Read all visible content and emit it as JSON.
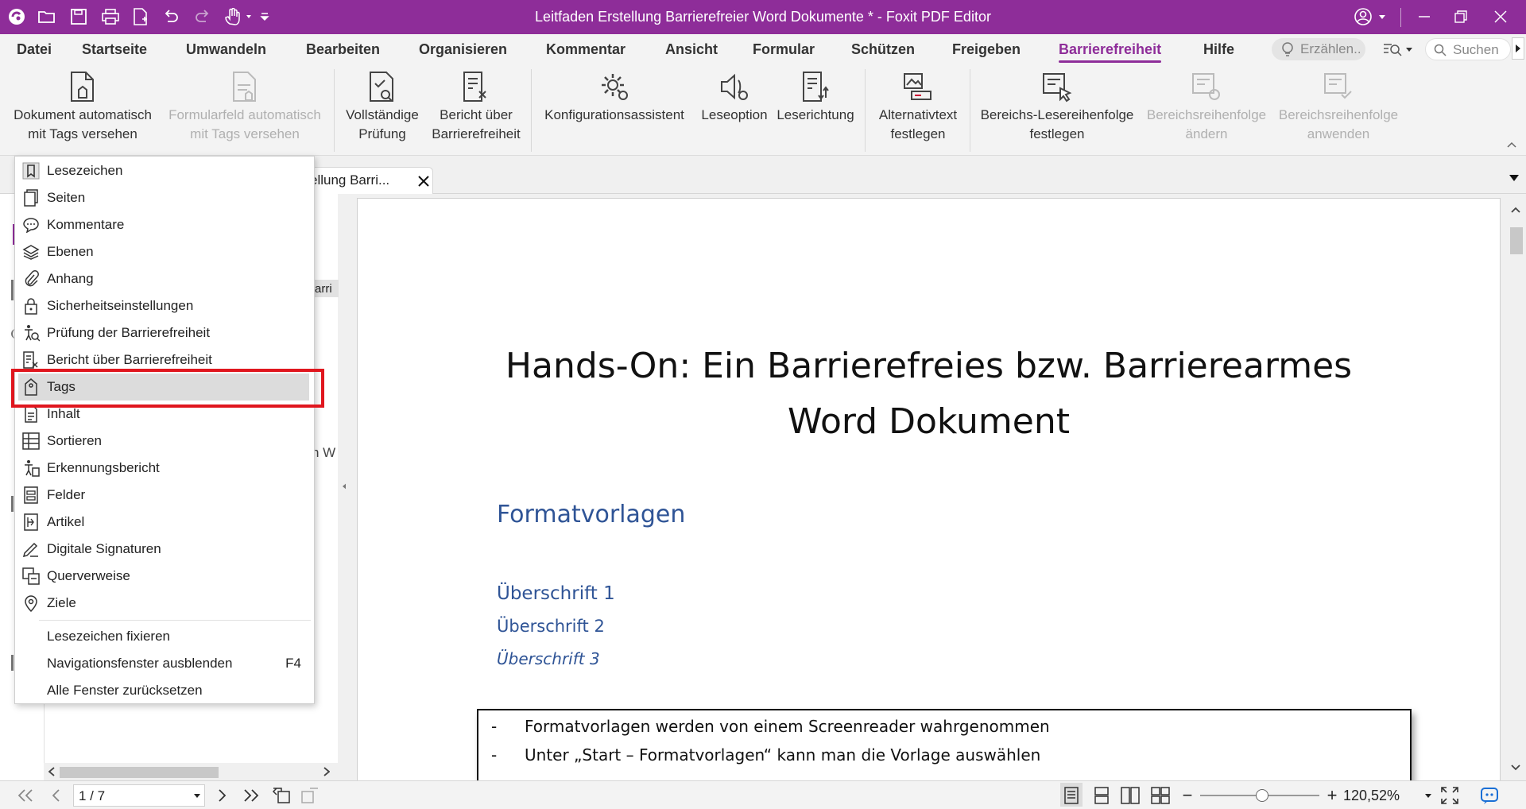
{
  "window": {
    "title": "Leitfaden Erstellung Barrierefreier Word Dokumente * - Foxit PDF Editor"
  },
  "menu_tabs": [
    "Datei",
    "Startseite",
    "Umwandeln",
    "Bearbeiten",
    "Organisieren",
    "Kommentar",
    "Ansicht",
    "Formular",
    "Schützen",
    "Freigeben",
    "Barrierefreiheit",
    "Hilfe"
  ],
  "active_tab": "Barrierefreiheit",
  "tell_me_placeholder": "Erzählen..",
  "search_placeholder": "Suchen",
  "ribbon": {
    "b1_line1": "Dokument automatisch",
    "b1_line2": "mit Tags versehen",
    "b2_line1": "Formularfeld automatisch",
    "b2_line2": "mit Tags versehen",
    "b3_line1": "Vollständige",
    "b3_line2": "Prüfung",
    "b4_line1": "Bericht über",
    "b4_line2": "Barrierefreiheit",
    "b5": "Konfigurationsassistent",
    "b6": "Leseoption",
    "b7": "Leserichtung",
    "b8_line1": "Alternativtext",
    "b8_line2": "festlegen",
    "b9_line1": "Bereichs-Lesereihenfolge",
    "b9_line2": "festlegen",
    "b10_line1": "Bereichsreihenfolge",
    "b10_line2": "ändern",
    "b11_line1": "Bereichsreihenfolge",
    "b11_line2": "anwenden"
  },
  "doc_tab": {
    "label": "ellung Barri..."
  },
  "nav_fragments": {
    "f1": "arri",
    "f2": "n W"
  },
  "panel_menu": {
    "items": [
      {
        "label": "Lesezeichen",
        "icon": "bookmark-icon"
      },
      {
        "label": "Seiten",
        "icon": "pages-icon"
      },
      {
        "label": "Kommentare",
        "icon": "comments-icon"
      },
      {
        "label": "Ebenen",
        "icon": "layers-icon"
      },
      {
        "label": "Anhang",
        "icon": "paperclip-icon"
      },
      {
        "label": "Sicherheitseinstellungen",
        "icon": "lock-icon"
      },
      {
        "label": "Prüfung der Barrierefreiheit",
        "icon": "accessibility-check-icon"
      },
      {
        "label": "Bericht über Barrierefreiheit",
        "icon": "accessibility-report-icon"
      },
      {
        "label": "Tags",
        "icon": "tag-icon"
      },
      {
        "label": "Inhalt",
        "icon": "content-icon"
      },
      {
        "label": "Sortieren",
        "icon": "order-icon"
      },
      {
        "label": "Erkennungsbericht",
        "icon": "recognition-report-icon"
      },
      {
        "label": "Felder",
        "icon": "fields-icon"
      },
      {
        "label": "Artikel",
        "icon": "articles-icon"
      },
      {
        "label": "Digitale Signaturen",
        "icon": "signature-icon"
      },
      {
        "label": "Querverweise",
        "icon": "cross-reference-icon"
      },
      {
        "label": "Ziele",
        "icon": "destination-icon"
      }
    ],
    "extra": [
      {
        "label": "Lesezeichen fixieren",
        "shortcut": ""
      },
      {
        "label": "Navigationsfenster ausblenden",
        "shortcut": "F4"
      },
      {
        "label": "Alle Fenster zurücksetzen",
        "shortcut": ""
      }
    ],
    "highlighted": "Tags"
  },
  "document": {
    "title_line1": "Hands-On: Ein Barrierefreies bzw. Barrierearmes",
    "title_line2": "Word Dokument",
    "heading": "Formatvorlagen",
    "h1": "Überschrift 1",
    "h2": "Überschrift 2",
    "h3": "Überschrift 3",
    "bullets": [
      "Formatvorlagen werden von einem Screenreader wahrgenommen",
      "Unter „Start – Formatvorlagen“ kann man die Vorlage auswählen"
    ],
    "bullet_dash": "-"
  },
  "statusbar": {
    "page_value": "1 / 7",
    "zoom_value": "120,52%",
    "zoom_minus": "−",
    "zoom_plus": "+"
  },
  "colors": {
    "brand": "#8e2d99",
    "heading_blue": "#2f5496",
    "highlight_box": "#e0161e"
  }
}
